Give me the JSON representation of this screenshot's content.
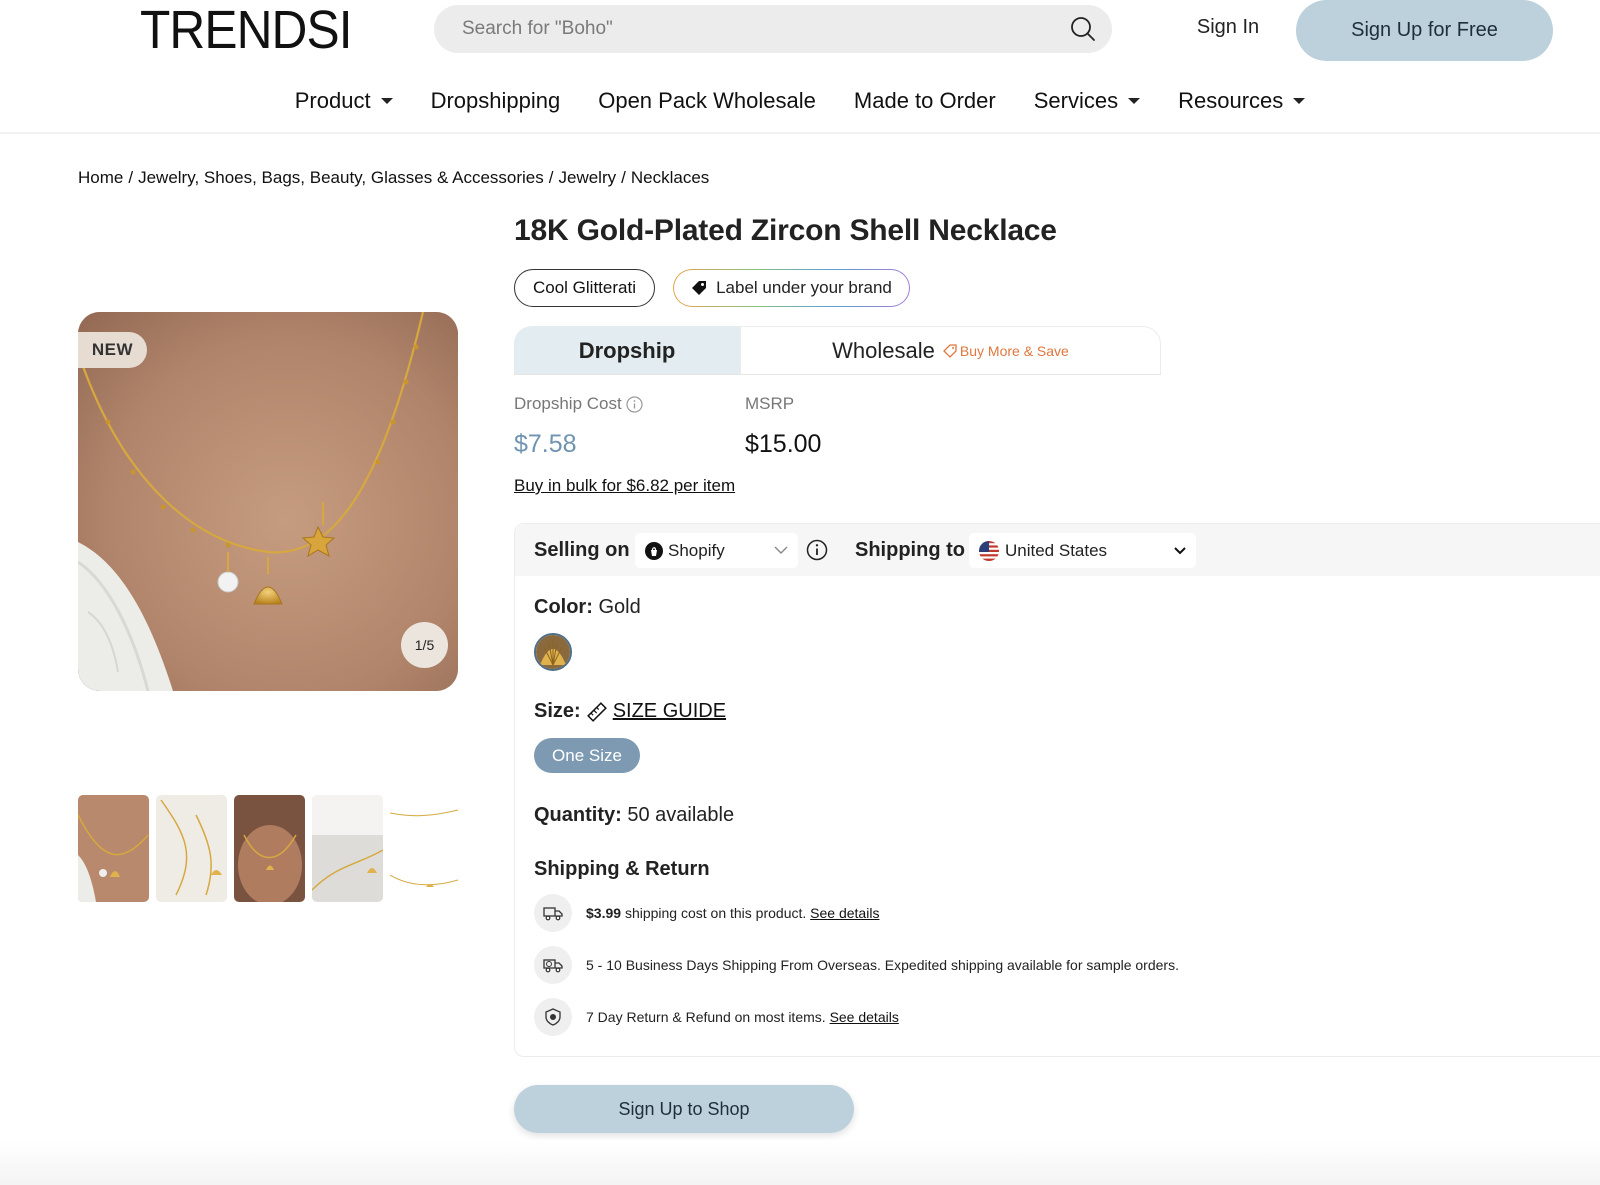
{
  "header": {
    "logo": "TRENDSI",
    "search_placeholder": "Search for \"Boho\"",
    "sign_in": "Sign In",
    "sign_up": "Sign Up for Free"
  },
  "nav": {
    "items": [
      "Product",
      "Dropshipping",
      "Open Pack Wholesale",
      "Made to Order",
      "Services",
      "Resources"
    ]
  },
  "breadcrumb": [
    "Home",
    "Jewelry, Shoes, Bags, Beauty, Glasses & Accessories",
    "Jewelry",
    "Necklaces"
  ],
  "gallery": {
    "badge": "NEW",
    "counter": "1/5"
  },
  "product": {
    "title": "18K Gold-Plated Zircon Shell Necklace",
    "brand": "Cool Glitterati",
    "label_chip": "Label under your brand"
  },
  "tabs": {
    "dropship": "Dropship",
    "wholesale": "Wholesale",
    "wholesale_promo": "Buy More & Save"
  },
  "pricing": {
    "cost_label": "Dropship Cost",
    "cost_value": "$7.58",
    "msrp_label": "MSRP",
    "msrp_value": "$15.00",
    "bulk_link": "Buy in bulk for $6.82 per item"
  },
  "options": {
    "selling_label": "Selling on",
    "platform": "Shopify",
    "shipping_label": "Shipping to",
    "country": "United States",
    "color_label": "Color:",
    "color_value": "Gold",
    "size_label": "Size:",
    "size_guide": "SIZE GUIDE",
    "size_option": "One Size",
    "qty_label": "Quantity:",
    "qty_value": "50 available"
  },
  "shipping_return": {
    "title": "Shipping & Return",
    "row1_price": "$3.99",
    "row1_text": "shipping cost on this product.",
    "row1_link": "See details",
    "row2_text": "5 - 10 Business Days Shipping From Overseas. Expedited shipping available for sample orders.",
    "row3_text": "7 Day Return & Refund on most items.",
    "row3_link": "See details"
  },
  "cta": "Sign Up to Shop",
  "colors": {
    "accent_light": "#bcd1dc",
    "price_blue": "#6f93b0",
    "size_chip": "#7d9ab2",
    "promo_orange": "#e0773d"
  }
}
